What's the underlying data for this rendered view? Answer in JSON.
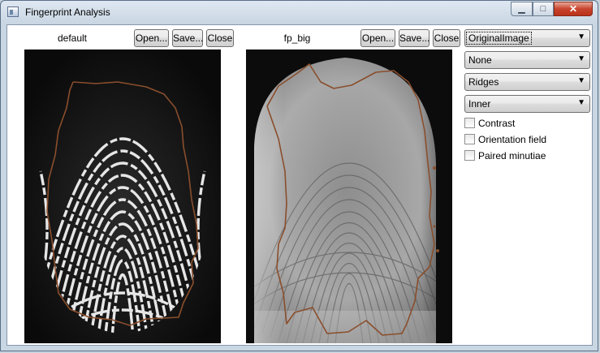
{
  "window": {
    "title": "Fingerprint Analysis",
    "minimize_glyph": "▁",
    "maximize_glyph": "□",
    "close_glyph": "✕"
  },
  "left_pane": {
    "label": "default",
    "open_label": "Open...",
    "save_label": "Save...",
    "close_label": "Close"
  },
  "right_pane": {
    "label": "fp_big",
    "open_label": "Open...",
    "save_label": "Save...",
    "close_label": "Close"
  },
  "controls": {
    "combos": [
      {
        "value": "OriginalImage"
      },
      {
        "value": "None"
      },
      {
        "value": "Ridges"
      },
      {
        "value": "Inner"
      }
    ],
    "checkboxes": [
      {
        "label": "Contrast",
        "checked": false
      },
      {
        "label": "Orientation field",
        "checked": false
      },
      {
        "label": "Paired minutiae",
        "checked": false
      }
    ]
  },
  "colors": {
    "outline": "#8a4e2c",
    "title_text": "#000000"
  }
}
